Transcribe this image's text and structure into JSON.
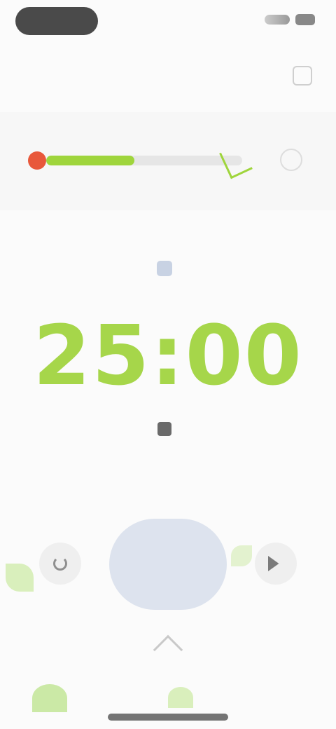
{
  "status_bar": {
    "time": "",
    "icons": [
      "signal-icon",
      "battery-icon"
    ]
  },
  "header": {
    "title": "",
    "action_icon": "settings-icon"
  },
  "progress": {
    "label": "",
    "right_label": "",
    "fill_fraction": 0.45,
    "colors": {
      "start": "#e8583b",
      "fill": "#9fd53c",
      "track": "#e6e6e6"
    }
  },
  "focus": {
    "label": "",
    "icon": "focus-icon"
  },
  "timer": {
    "value": "25:00",
    "color": "#a6d64a"
  },
  "session": {
    "label": "",
    "icon": "session-icon"
  },
  "controls": {
    "reset_icon": "reset-icon",
    "start_label": "",
    "skip_icon": "skip-icon",
    "start_color": "#dde3ee"
  },
  "footer": {
    "expand_icon": "chevron-up-icon"
  }
}
